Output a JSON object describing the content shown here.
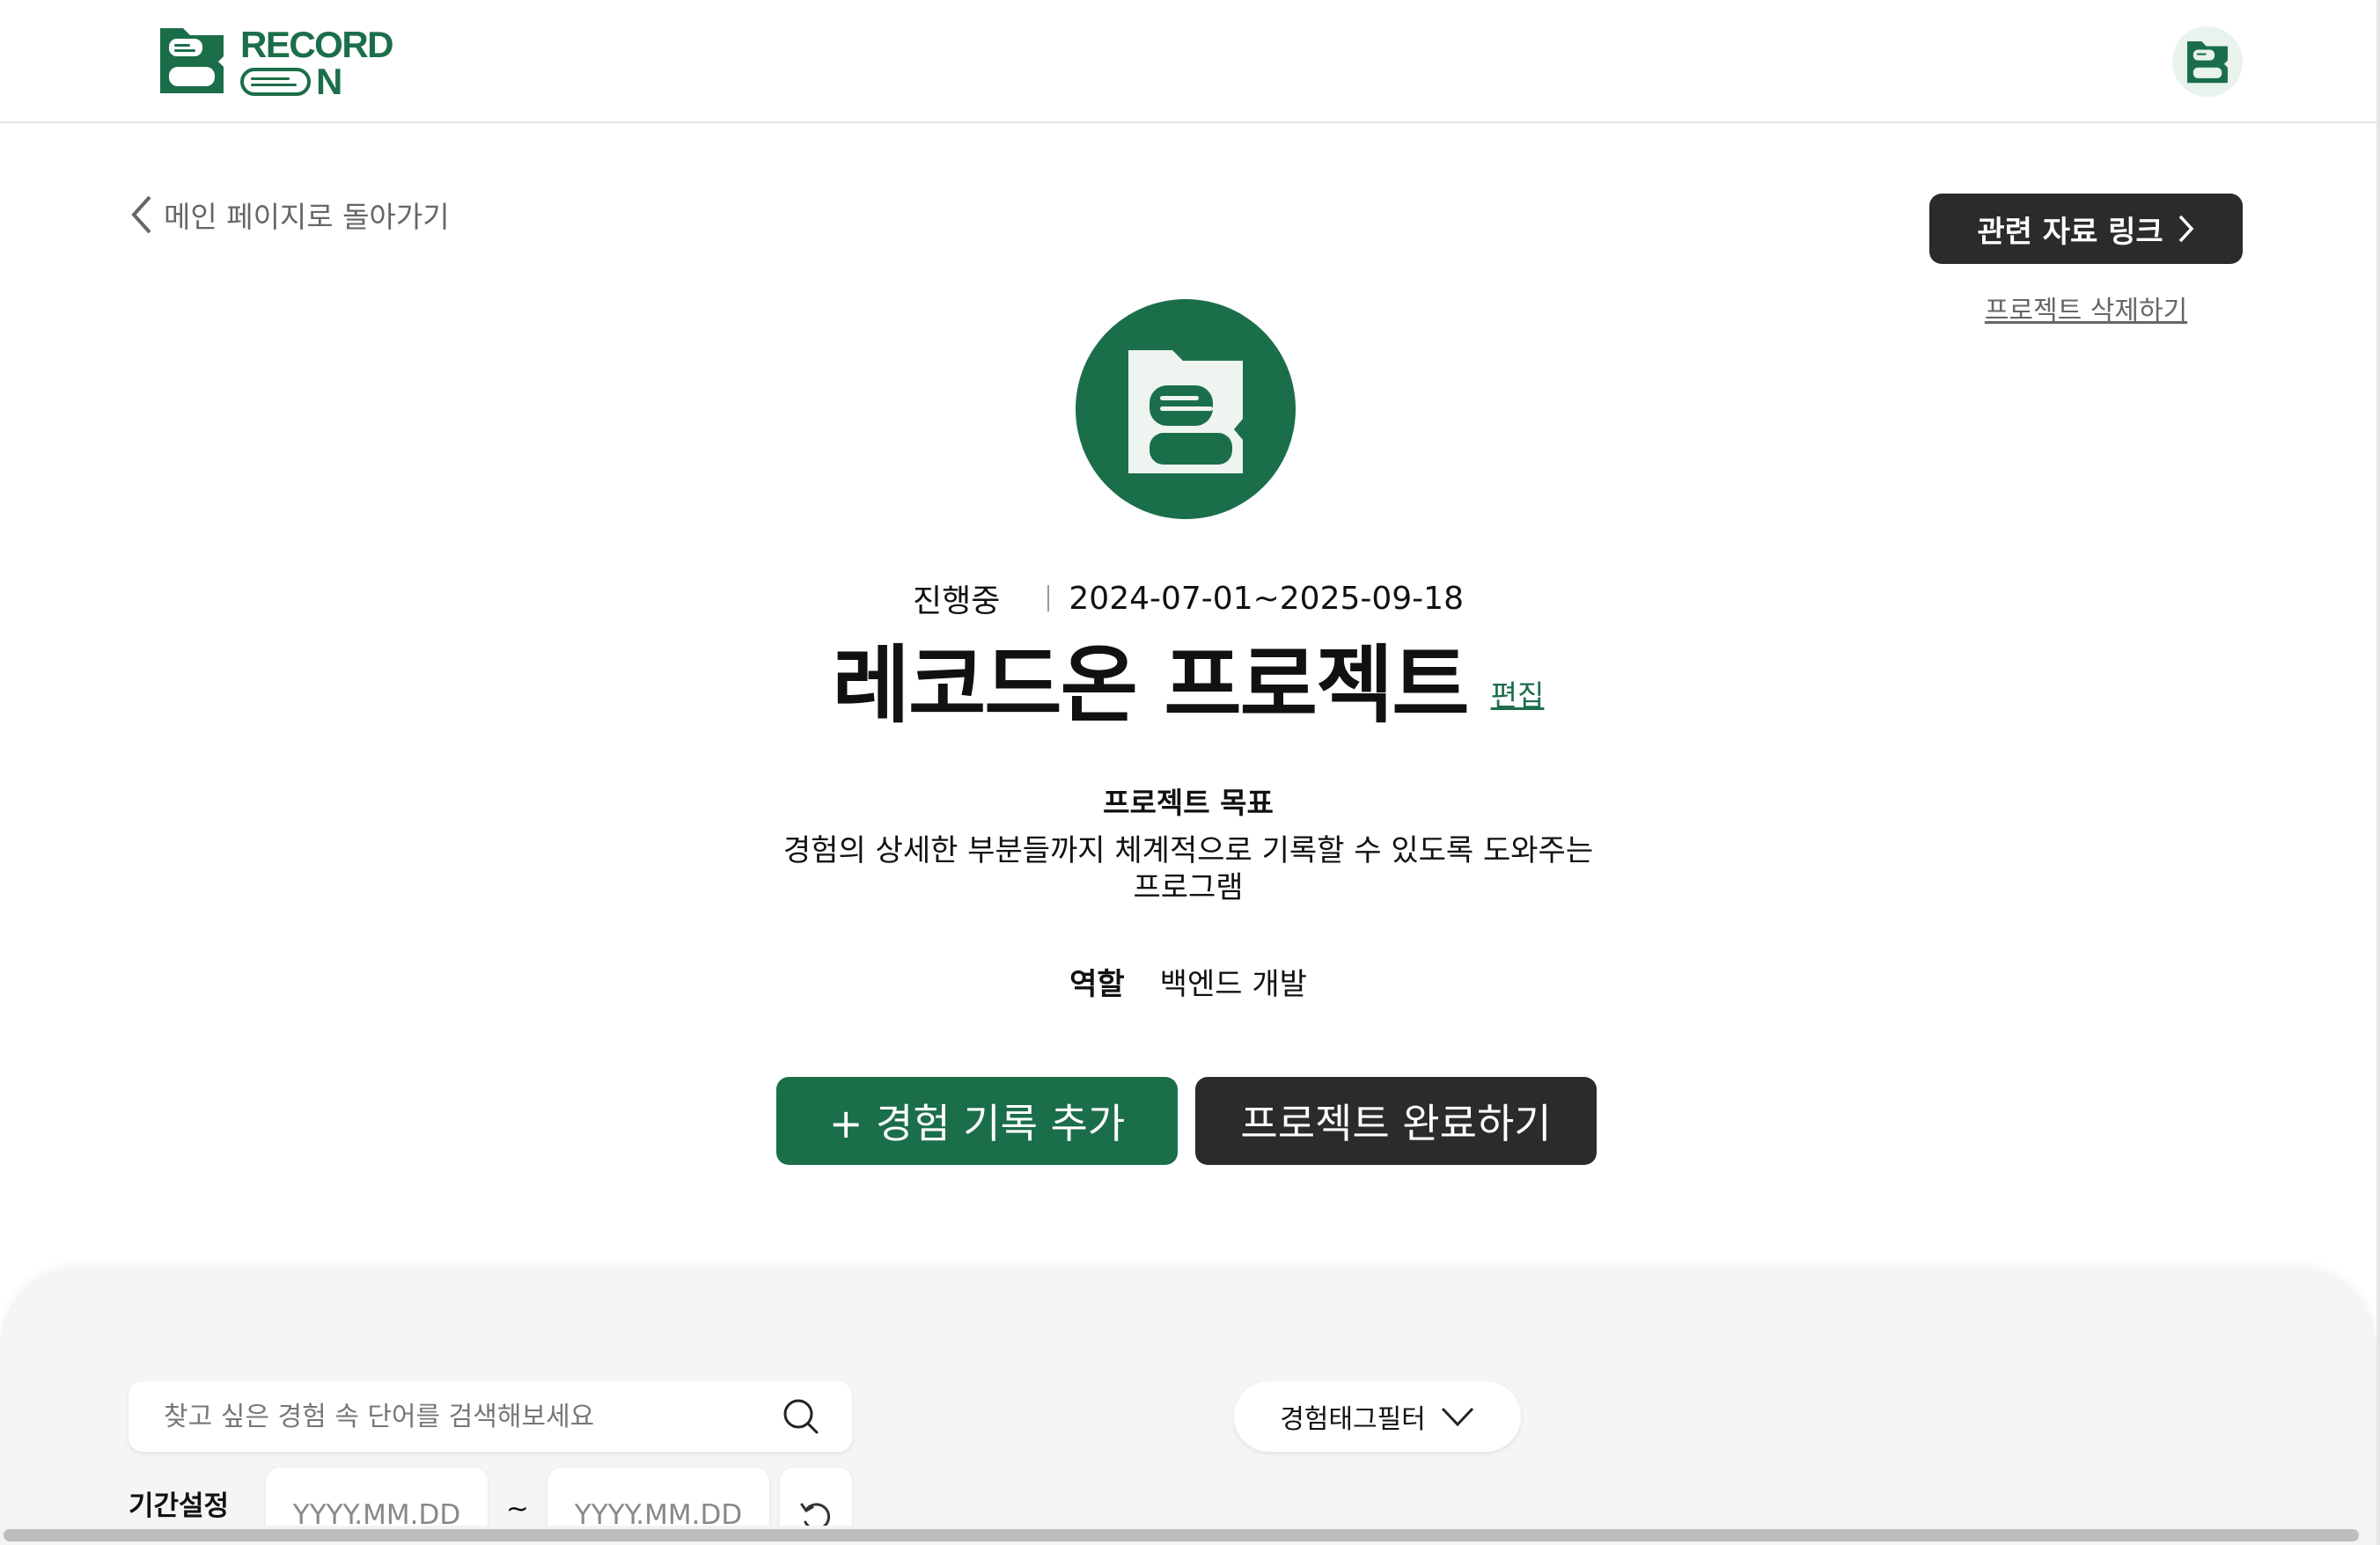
{
  "brand": {
    "logo_line1": "RECORD",
    "logo_line2_suffix": "N",
    "accent": "#1b6e4a",
    "dark": "#2b2b2b"
  },
  "header": {
    "profile_icon": "record-on-logo-icon"
  },
  "nav": {
    "back_label": "메인 페이지로 돌아가기",
    "related_link_label": "관련 자료 링크",
    "delete_label": "프로젝트 삭제하기"
  },
  "project": {
    "status": "진행중",
    "period": "2024-07-01~2025-09-18",
    "title": "레코드온 프로젝트",
    "edit_label": "편집",
    "goal_label": "프로젝트 목표",
    "goal_text": "경험의 상세한 부분들까지 체계적으로 기록할 수 있도록 도와주는 프로그램",
    "role_label": "역할",
    "role_value": "백엔드 개발"
  },
  "actions": {
    "add_label": "+ 경험 기록 추가",
    "complete_label": "프로젝트 완료하기"
  },
  "filters": {
    "search_placeholder": "찾고 싶은 경험 속 단어를 검색해보세요",
    "tag_filter_label": "경험태그필터",
    "period_label": "기간설정",
    "start_placeholder": "YYYY.MM.DD",
    "end_placeholder": "YYYY.MM.DD",
    "tilde": "~"
  }
}
